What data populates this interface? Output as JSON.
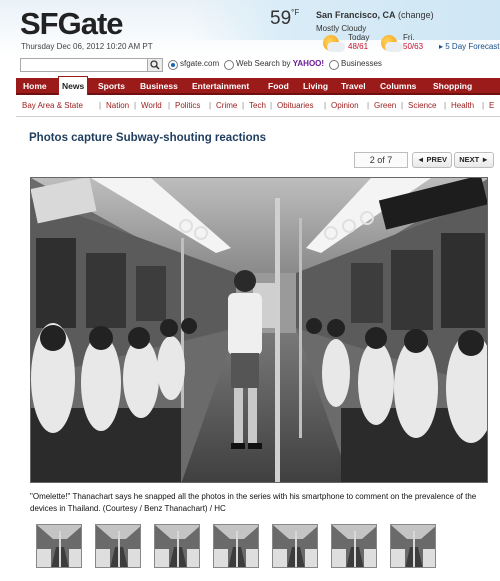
{
  "header": {
    "logo": "SFGate",
    "datetime": "Thursday Dec 06, 2012 10:20 AM PT",
    "weather": {
      "temp": "59",
      "unit": "°F",
      "city": "San Francisco, CA",
      "change_link": "(change)",
      "condition": "Mostly Cloudy",
      "today_label": "Today",
      "today_range": "48/61",
      "fri_label": "Fri.",
      "fri_range": "50/63",
      "forecast_link": "5 Day Forecast"
    }
  },
  "search": {
    "placeholder": "",
    "options": [
      {
        "label": "sfgate.com",
        "selected": true
      },
      {
        "label": "Web Search by",
        "brand": "YAHOO!",
        "selected": false
      },
      {
        "label": "Businesses",
        "selected": false
      }
    ]
  },
  "nav": {
    "items": [
      "Home",
      "News",
      "Sports",
      "Business",
      "Entertainment",
      "Food",
      "Living",
      "Travel",
      "Columns",
      "Shopping"
    ],
    "active": "News"
  },
  "subnav": {
    "items": [
      "Bay Area & State",
      "Nation",
      "World",
      "Politics",
      "Crime",
      "Tech",
      "Obituaries",
      "Opinion",
      "Green",
      "Science",
      "Health",
      "E"
    ]
  },
  "gallery": {
    "title": "Photos capture Subway-shouting reactions",
    "count": "2 of 7",
    "prev_label": "◄ PREV",
    "next_label": "NEXT ►",
    "caption": "\"Omelette!\" Thanachart says he snapped all the photos in the series with his smartphone to comment on the prevalence of the devices in Thailand. (Courtesy / Benz Thanachart) / HC",
    "thumbnail_count": 7
  },
  "colors": {
    "nav_red": "#9b1b1b",
    "title_blue": "#1f3e5f",
    "link_red": "#9b1b1b"
  }
}
